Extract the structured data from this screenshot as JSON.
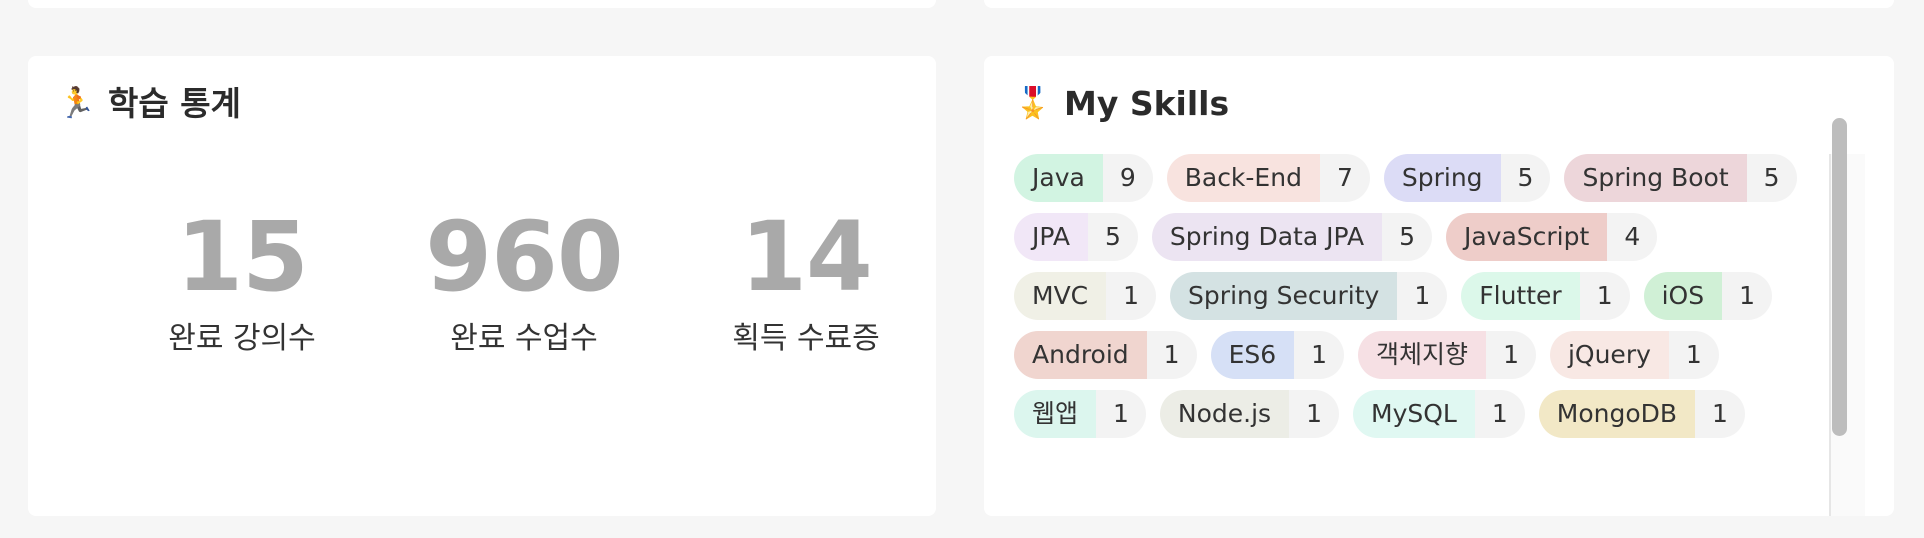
{
  "stats_card": {
    "icon": "running-person-icon",
    "emoji": "🏃",
    "title": "학습 통계",
    "stats": [
      {
        "value": "15",
        "label": "완료 강의수"
      },
      {
        "value": "960",
        "label": "완료 수업수"
      },
      {
        "value": "14",
        "label": "획득 수료증"
      }
    ]
  },
  "skills_card": {
    "icon": "medal-icon",
    "emoji": "🎖️",
    "title": "My Skills",
    "rows": [
      [
        {
          "name": "Java",
          "count": "9",
          "color": "#d2f4e2"
        },
        {
          "name": "Back-End",
          "count": "7",
          "color": "#f8e3df"
        },
        {
          "name": "Spring",
          "count": "5",
          "color": "#dcdcf6"
        },
        {
          "name": "Spring Boot",
          "count": "5",
          "color": "#edd6da"
        }
      ],
      [
        {
          "name": "JPA",
          "count": "5",
          "color": "#f1e7f7"
        },
        {
          "name": "Spring Data JPA",
          "count": "5",
          "color": "#ece4f2"
        },
        {
          "name": "JavaScript",
          "count": "4",
          "color": "#eecdc9"
        }
      ],
      [
        {
          "name": "MVC",
          "count": "1",
          "color": "#f0f0e6"
        },
        {
          "name": "Spring Security",
          "count": "1",
          "color": "#d4e2e3"
        },
        {
          "name": "Flutter",
          "count": "1",
          "color": "#dcf8ea"
        },
        {
          "name": "iOS",
          "count": "1",
          "color": "#d0f0d6"
        }
      ],
      [
        {
          "name": "Android",
          "count": "1",
          "color": "#f0d5cf"
        },
        {
          "name": "ES6",
          "count": "1",
          "color": "#d6e0f6"
        },
        {
          "name": "객체지향",
          "count": "1",
          "color": "#f6e0e4"
        },
        {
          "name": "jQuery",
          "count": "1",
          "color": "#f8e8e4"
        }
      ],
      [
        {
          "name": "웹앱",
          "count": "1",
          "color": "#dcf6ee"
        },
        {
          "name": "Node.js",
          "count": "1",
          "color": "#ecede6"
        },
        {
          "name": "MySQL",
          "count": "1",
          "color": "#e0f8f2"
        },
        {
          "name": "MongoDB",
          "count": "1",
          "color": "#f2e8c6"
        }
      ]
    ]
  }
}
